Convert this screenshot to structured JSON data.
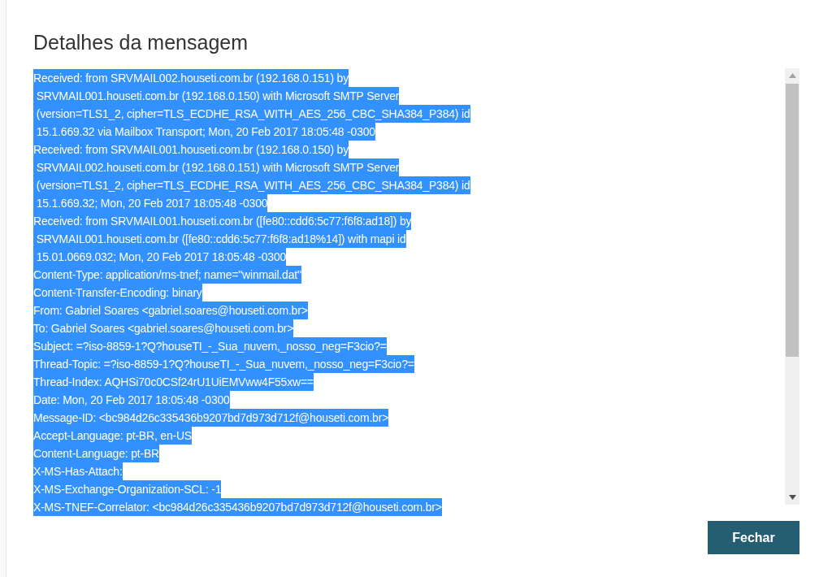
{
  "dialog": {
    "title": "Detalhes da mensagem"
  },
  "message_header": {
    "selected": true,
    "lines": [
      "Received: from SRVMAIL002.houseti.com.br (192.168.0.151) by",
      " SRVMAIL001.houseti.com.br (192.168.0.150) with Microsoft SMTP Server",
      " (version=TLS1_2, cipher=TLS_ECDHE_RSA_WITH_AES_256_CBC_SHA384_P384) id",
      " 15.1.669.32 via Mailbox Transport; Mon, 20 Feb 2017 18:05:48 -0300",
      "Received: from SRVMAIL001.houseti.com.br (192.168.0.150) by",
      " SRVMAIL002.houseti.com.br (192.168.0.151) with Microsoft SMTP Server",
      " (version=TLS1_2, cipher=TLS_ECDHE_RSA_WITH_AES_256_CBC_SHA384_P384) id",
      " 15.1.669.32; Mon, 20 Feb 2017 18:05:48 -0300",
      "Received: from SRVMAIL001.houseti.com.br ([fe80::cdd6:5c77:f6f8:ad18]) by",
      " SRVMAIL001.houseti.com.br ([fe80::cdd6:5c77:f6f8:ad18%14]) with mapi id",
      " 15.01.0669.032; Mon, 20 Feb 2017 18:05:48 -0300",
      "Content-Type: application/ms-tnef; name=\"winmail.dat\"",
      "Content-Transfer-Encoding: binary",
      "From: Gabriel Soares <gabriel.soares@houseti.com.br>",
      "To: Gabriel Soares <gabriel.soares@houseti.com.br>",
      "Subject: =?iso-8859-1?Q?houseTI_-_Sua_nuvem,_nosso_neg=F3cio?=",
      "Thread-Topic: =?iso-8859-1?Q?houseTI_-_Sua_nuvem,_nosso_neg=F3cio?=",
      "Thread-Index: AQHSi70c0CSf24rU1UiEMVww4F55xw==",
      "Date: Mon, 20 Feb 2017 18:05:48 -0300",
      "Message-ID: <bc984d26c335436b9207bd7d973d712f@houseti.com.br>",
      "Accept-Language: pt-BR, en-US",
      "Content-Language: pt-BR",
      "X-MS-Has-Attach:",
      "X-MS-Exchange-Organization-SCL: -1",
      "X-MS-TNEF-Correlator: <bc984d26c335436b9207bd7d973d712f@houseti.com.br>"
    ]
  },
  "buttons": [
    {
      "label": "Fechar"
    }
  ]
}
